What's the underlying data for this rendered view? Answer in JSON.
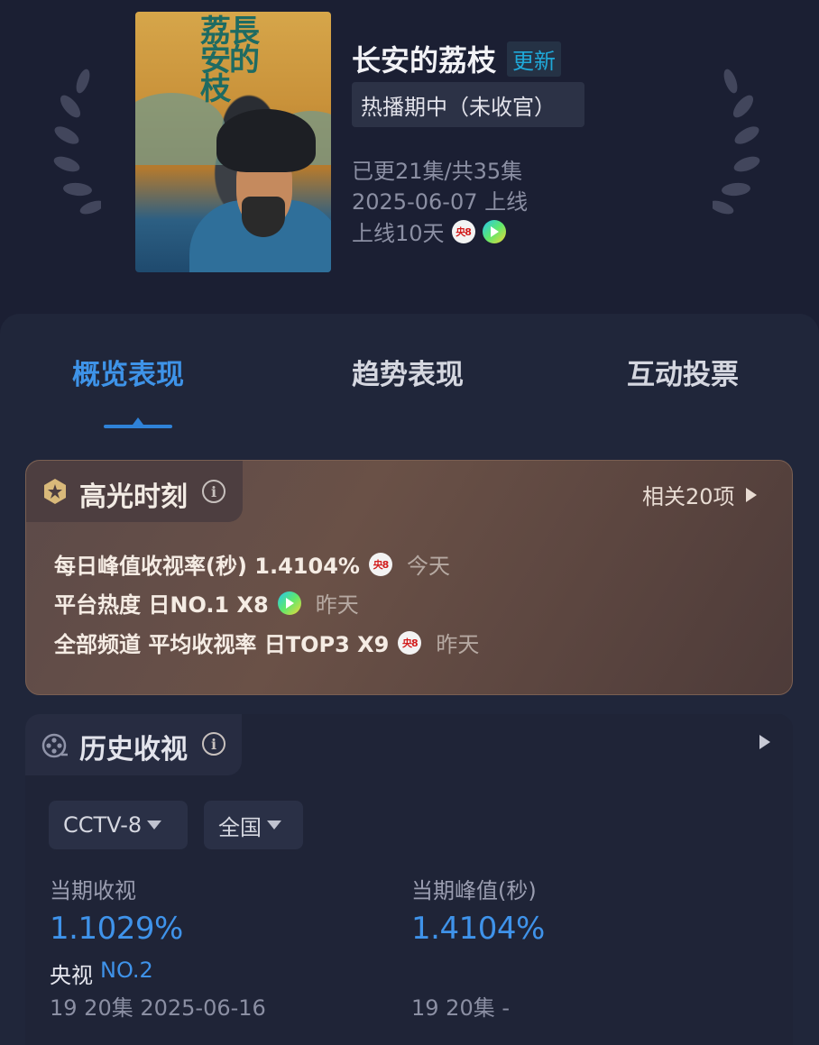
{
  "show": {
    "poster_calligraphy": "荔長安的枝",
    "title": "长安的荔枝",
    "update_badge": "更新",
    "status": "热播期中（未收官）",
    "episodes": "已更21集/共35集",
    "release": "2025-06-07 上线",
    "days_online": "上线10天",
    "platforms": [
      "cctv8-icon",
      "tencent-video-icon"
    ]
  },
  "tabs": [
    {
      "label": "概览表现",
      "active": true
    },
    {
      "label": "趋势表现",
      "active": false
    },
    {
      "label": "互动投票",
      "active": false
    }
  ],
  "highlights": {
    "title": "高光时刻",
    "info": "i",
    "more": "相关20项",
    "rows": [
      {
        "text": "每日峰值收视率(秒) 1.4104%",
        "platform": "cctv8-icon",
        "when": "今天"
      },
      {
        "text": "平台热度 日NO.1 X8",
        "platform": "tencent-video-icon",
        "when": "昨天"
      },
      {
        "text": "全部频道 平均收视率 日TOP3 X9",
        "platform": "cctv8-icon",
        "when": "昨天"
      }
    ]
  },
  "history": {
    "title": "历史收视",
    "info": "i",
    "channel": "CCTV-8",
    "region": "全国",
    "current_label": "当期收视",
    "current_value": "1.1029%",
    "rank_prefix": "央视",
    "rank": "NO.2",
    "current_sub": "19 20集 2025-06-16",
    "peak_label": "当期峰值(秒)",
    "peak_value": "1.4104%",
    "peak_sub": "19 20集 -"
  },
  "colors": {
    "accent": "#3f93ea",
    "background": "#1b1f33",
    "update_badge": "#1fa8d8",
    "highlight_card": "#5c4a49"
  }
}
